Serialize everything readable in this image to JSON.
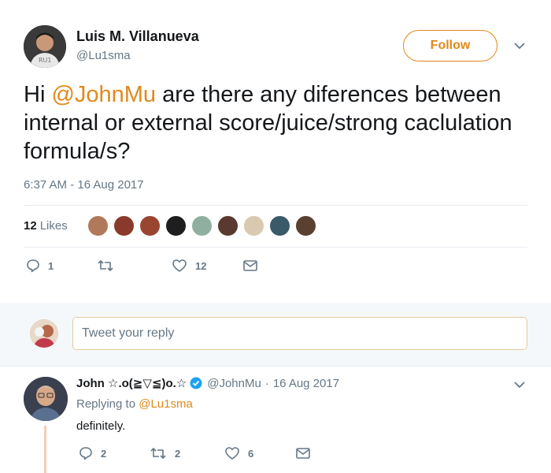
{
  "tweet": {
    "author_name": "Luis M. Villanueva",
    "author_handle": "@Lu1sma",
    "follow_label": "Follow",
    "text_greeting": "Hi ",
    "text_mention": "@JohnMu",
    "text_rest": " are there any diferences between internal or external score/juice/strong caclulation formula/s?",
    "timestamp": "6:37 AM - 16 Aug 2017",
    "likes_count": "12",
    "likes_label": "Likes",
    "actions": {
      "reply_count": "1",
      "retweet_count": "",
      "like_count": "12"
    },
    "accent_color": "#e0891c"
  },
  "reply_box": {
    "placeholder": "Tweet your reply"
  },
  "reply": {
    "author_name": "John ☆.o(≧▽≦)o.☆",
    "author_handle": "@JohnMu",
    "separator": "·",
    "date": "16 Aug 2017",
    "replying_to_prefix": "Replying to ",
    "replying_to_handle": "@Lu1sma",
    "text": "definitely.",
    "actions": {
      "reply_count": "2",
      "retweet_count": "2",
      "like_count": "6"
    }
  },
  "liker_avatar_colors": [
    "#b07a5a",
    "#8a3a2a",
    "#9a4530",
    "#1e1e1e",
    "#8fb0a0",
    "#5a3a30",
    "#d9c9b0",
    "#3a5a6a",
    "#5a4030"
  ],
  "icons": [
    "caret-down-icon",
    "reply-icon",
    "retweet-icon",
    "heart-icon",
    "message-icon",
    "verified-badge-icon"
  ]
}
